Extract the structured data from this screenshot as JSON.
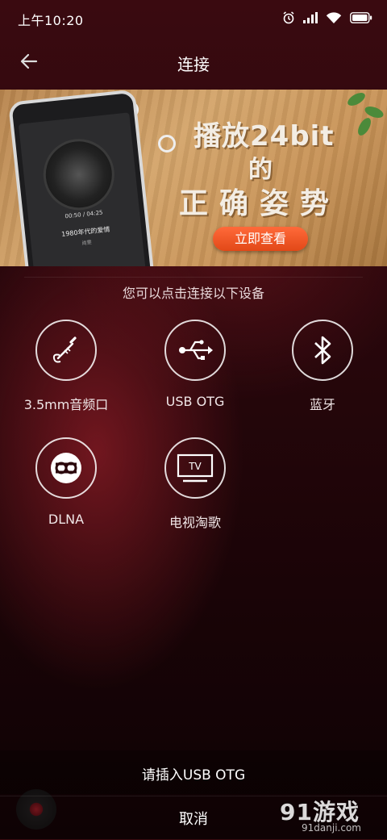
{
  "status_bar": {
    "time": "上午10:20",
    "icons": [
      "alarm-icon",
      "signal-icon",
      "wifi-icon",
      "battery-icon"
    ]
  },
  "nav": {
    "title": "连接",
    "back_icon": "arrow-left-icon"
  },
  "banner": {
    "headline_1": "播放24bit",
    "headline_2": "的",
    "headline_3": "正确姿势",
    "cta_label": "立即查看",
    "phone_time": "00:50 / 04:25",
    "phone_song": "1980年代的爱情",
    "phone_artist": "尚雯"
  },
  "section_hint": "您可以点击连接以下设备",
  "devices": [
    {
      "label": "3.5mm音频口",
      "icon": "headphone-jack-icon"
    },
    {
      "label": "USB OTG",
      "icon": "usb-icon"
    },
    {
      "label": "蓝牙",
      "icon": "bluetooth-icon"
    },
    {
      "label": "DLNA",
      "icon": "dlna-icon"
    },
    {
      "label": "电视淘歌",
      "icon": "tv-icon",
      "icon_text": "TV"
    }
  ],
  "prompt": "请插入USB OTG",
  "cancel_label": "取消",
  "watermark": {
    "logo": "91游戏",
    "url": "91danji.com"
  },
  "colors": {
    "background_top": "#3a0a10",
    "background_bottom": "#0e0204",
    "cta": "#e24817"
  }
}
